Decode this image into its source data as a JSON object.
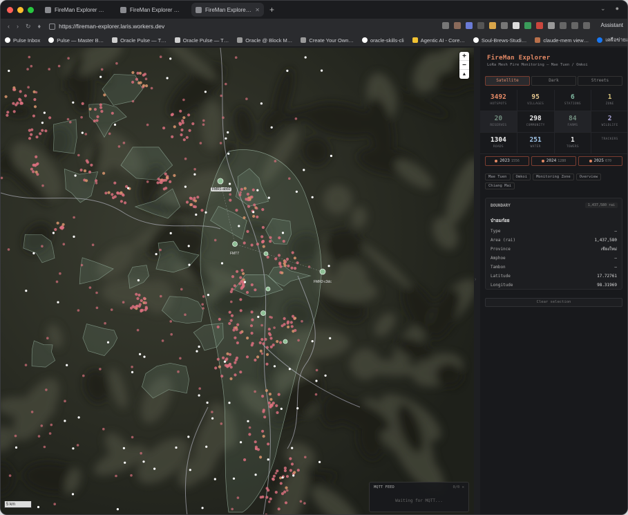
{
  "browser": {
    "tabs": [
      {
        "label": "FireMan Explorer — LoRa M…",
        "active": false
      },
      {
        "label": "FireMan Explorer — LoRa M…",
        "active": false
      },
      {
        "label": "FireMan Explorer — LoRa M…",
        "active": true
      }
    ],
    "url": "https://fireman-explorer.laris.workers.dev",
    "assistant_label": "Assistant",
    "bookmarks": [
      {
        "label": "Pulse Inbox",
        "icon": "github-icon",
        "color": "#ffffff"
      },
      {
        "label": "Pulse — Master B…",
        "icon": "github-icon",
        "color": "#ffffff"
      },
      {
        "label": "Oracle Pulse — T…",
        "icon": "page-icon",
        "color": "#cfcfcf"
      },
      {
        "label": "Oracle Pulse — T…",
        "icon": "page-icon",
        "color": "#cfcfcf"
      },
      {
        "label": "Oracle @ Block M…",
        "icon": "globe-icon",
        "color": "#9a9a9a"
      },
      {
        "label": "Create Your Own…",
        "icon": "globe-icon",
        "color": "#9a9a9a"
      },
      {
        "label": "oracle-skills-cli",
        "icon": "github-icon",
        "color": "#ffffff"
      },
      {
        "label": "Agentic AI - Core…",
        "icon": "page-icon",
        "color": "#f1c232"
      },
      {
        "label": "Soul-Brews-Studi…",
        "icon": "github-icon",
        "color": "#ffffff"
      },
      {
        "label": "claude-mem view…",
        "icon": "claude-icon",
        "color": "#b8704b"
      },
      {
        "label": "เครือข่ายอบรม AI (…",
        "icon": "facebook-icon",
        "color": "#1877f2"
      }
    ]
  },
  "map": {
    "zoom_in": "+",
    "zoom_out": "−",
    "compass": "▲",
    "scale": "5 km",
    "stations": [
      {
        "label": "FMR1-ab60"
      },
      {
        "label": "FMT7"
      },
      {
        "label": "FMR2-c3dc"
      }
    ],
    "mqtt": {
      "title": "MQTT FEED",
      "status": "0/0 ✕",
      "waiting": "Waiting for MQTT..."
    }
  },
  "panel": {
    "title": "FireMan Explorer",
    "subtitle": "LoRa Mesh Fire Monitoring — Mae Tuen / Omkoi",
    "modes": [
      {
        "label": "Satellite",
        "active": true
      },
      {
        "label": "Dark",
        "active": false
      },
      {
        "label": "Streets",
        "active": false
      }
    ],
    "stats": [
      [
        {
          "value": "3492",
          "label": "HOTSPOTS",
          "color": "#e58a66",
          "dim": false
        },
        {
          "value": "95",
          "label": "VILLAGES",
          "color": "#e3c48e",
          "dim": false
        },
        {
          "value": "6",
          "label": "STATIONS",
          "color": "#7fb7a0",
          "dim": false
        },
        {
          "value": "1",
          "label": "ZONE",
          "color": "#d6c27a",
          "dim": false
        }
      ],
      [
        {
          "value": "20",
          "label": "RESERVES",
          "color": "#6f8a7c",
          "dim": true
        },
        {
          "value": "298",
          "label": "COMMUNITY",
          "color": "#e8e8e8",
          "dim": false
        },
        {
          "value": "84",
          "label": "FARMS",
          "color": "#6f8a7c",
          "dim": true
        },
        {
          "value": "2",
          "label": "WILDLIFE",
          "color": "#a9a4d6",
          "dim": false
        }
      ],
      [
        {
          "value": "1304",
          "label": "ROADS",
          "color": "#f0f0f0",
          "dim": false
        },
        {
          "value": "251",
          "label": "WATER",
          "color": "#9ec3e6",
          "dim": false
        },
        {
          "value": "1",
          "label": "TOWERS",
          "color": "#e8e8e8",
          "dim": false
        },
        {
          "value": "",
          "label": "TRACKERS",
          "color": "#e8e8e8",
          "dim": false
        }
      ]
    ],
    "years": [
      {
        "year": "2023",
        "count": "1556"
      },
      {
        "year": "2024",
        "count": "1280"
      },
      {
        "year": "2025",
        "count": "670"
      }
    ],
    "chips": [
      "Mae Tuen",
      "Omkoi",
      "Monitoring Zone",
      "Overview",
      "Chiang Mai"
    ],
    "boundary": {
      "title": "BOUNDARY",
      "area_badge": "1,437,580 rai",
      "name": "ป่าอมก๋อย",
      "rows": [
        {
          "key": "Type",
          "value": "—"
        },
        {
          "key": "Area (rai)",
          "value": "1,437,580"
        },
        {
          "key": "Province",
          "value": "เชียงใหม่"
        },
        {
          "key": "Amphoe",
          "value": "—"
        },
        {
          "key": "Tambon",
          "value": "—"
        },
        {
          "key": "Latitude",
          "value": "17.72761"
        },
        {
          "key": "Longitude",
          "value": "98.31969"
        }
      ]
    },
    "clear_label": "Clear selection"
  },
  "colors": {
    "accent": "#e58a66",
    "hotspot": "#d9707e",
    "station": "#8fbf96",
    "panel_bg": "#18191c"
  }
}
